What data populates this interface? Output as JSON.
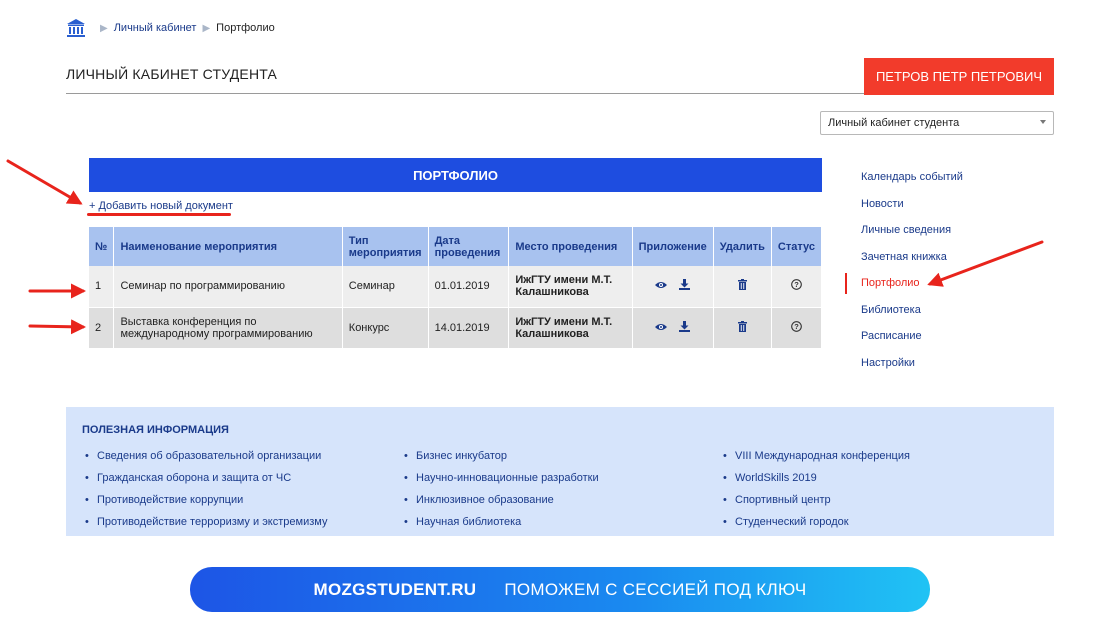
{
  "breadcrumb": {
    "items": [
      "Личный кабинет",
      "Портфолио"
    ]
  },
  "header": {
    "title": "ЛИЧНЫЙ КАБИНЕТ СТУДЕНТА",
    "user_name": "ПЕТРОВ ПЕТР ПЕТРОВИЧ"
  },
  "cabinet_select": {
    "value": "Личный кабинет студента"
  },
  "portfolio": {
    "title": "ПОРТФОЛИО",
    "add_label": "+ Добавить новый документ",
    "columns": {
      "n": "№",
      "name": "Наименование мероприятия",
      "type": "Тип мероприятия",
      "date": "Дата проведения",
      "place": "Место проведения",
      "attachment": "Приложение",
      "delete": "Удалить",
      "status": "Статус"
    },
    "rows": [
      {
        "n": "1",
        "name": "Семинар по программированию",
        "type": "Семинар",
        "date": "01.01.2019",
        "place": "ИжГТУ имени М.Т. Калашникова"
      },
      {
        "n": "2",
        "name": "Выставка конференция по международному программированию",
        "type": "Конкурс",
        "date": "14.01.2019",
        "place": "ИжГТУ имени М.Т. Калашникова"
      }
    ]
  },
  "side_nav": {
    "items": [
      "Календарь событий",
      "Новости",
      "Личные сведения",
      "Зачетная книжка",
      "Портфолио",
      "Библиотека",
      "Расписание",
      "Настройки"
    ],
    "active": "Портфолио"
  },
  "info": {
    "title": "ПОЛЕЗНАЯ ИНФОРМАЦИЯ",
    "col1": [
      "Сведения об образовательной организации",
      "Гражданская оборона и защита от ЧС",
      "Противодействие коррупции",
      "Противодействие терроризму и экстремизму"
    ],
    "col2": [
      "Бизнес инкубатор",
      "Научно-инновационные разработки",
      "Инклюзивное образование",
      "Научная библиотека"
    ],
    "col3": [
      "VIII Международная конференция",
      "WorldSkills 2019",
      "Спортивный центр",
      "Студенческий городок"
    ]
  },
  "banner": {
    "brand": "MOZGSTUDENT.RU",
    "text": "ПОМОЖЕМ С СЕССИЕЙ ПОД КЛЮЧ"
  },
  "colors": {
    "accent_blue": "#1e4de0",
    "accent_red": "#f23b2b",
    "link": "#1a3a8a",
    "header_cell": "#a8c2ef",
    "info_bg": "#d6e4fb"
  },
  "icons": [
    "home-icon",
    "eye-icon",
    "download-icon",
    "trash-icon",
    "question-circle-icon",
    "chevron-down-icon",
    "annotation-arrow"
  ]
}
